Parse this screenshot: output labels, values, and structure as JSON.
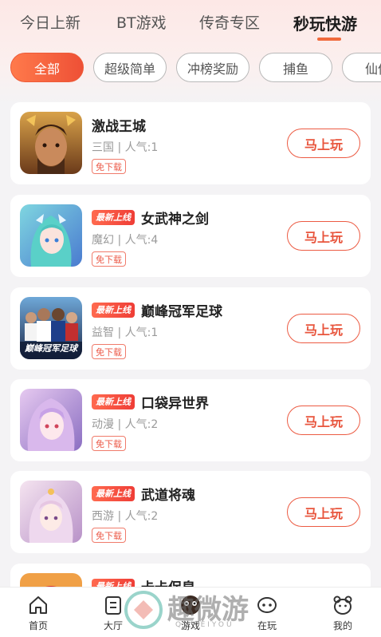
{
  "tabs": [
    {
      "label": "今日上新"
    },
    {
      "label": "BT游戏"
    },
    {
      "label": "传奇专区"
    },
    {
      "label": "秒玩快游"
    }
  ],
  "active_tab": "秒玩快游",
  "filters": [
    {
      "label": "全部"
    },
    {
      "label": "超级简单"
    },
    {
      "label": "冲榜奖励"
    },
    {
      "label": "捕鱼"
    },
    {
      "label": "仙侠"
    }
  ],
  "active_filter": "全部",
  "games": [
    {
      "name": "激战王城",
      "meta": "三国 | 人气:1",
      "free": "免下载",
      "action": "马上玩",
      "badge": ""
    },
    {
      "name": "女武神之剑",
      "meta": "魔幻 | 人气:4",
      "free": "免下载",
      "action": "马上玩",
      "badge": "最新上线"
    },
    {
      "name": "巅峰冠军足球",
      "meta": "益智 | 人气:1",
      "free": "免下载",
      "action": "马上玩",
      "badge": "最新上线",
      "thumb_text": "巅峰冠军足球"
    },
    {
      "name": "口袋异世界",
      "meta": "动漫 | 人气:2",
      "free": "免下载",
      "action": "马上玩",
      "badge": "最新上线"
    },
    {
      "name": "武道将魂",
      "meta": "西游 | 人气:2",
      "free": "免下载",
      "action": "马上玩",
      "badge": "最新上线"
    },
    {
      "name": "卡卡保皇",
      "badge": "最新上线"
    }
  ],
  "bottom_nav": [
    {
      "label": "首页",
      "icon": "home-icon"
    },
    {
      "label": "大厅",
      "icon": "hall-icon"
    },
    {
      "label": "游戏",
      "icon": "game-icon"
    },
    {
      "label": "在玩",
      "icon": "playing-icon"
    },
    {
      "label": "我的",
      "icon": "profile-icon"
    }
  ],
  "watermark": {
    "text": "趣微游",
    "sub": "QUWEIYOU"
  },
  "colors": {
    "accent": "#ee5b38",
    "badge": "#ef3d36",
    "text": "#222222",
    "muted": "#9a9a9a"
  }
}
